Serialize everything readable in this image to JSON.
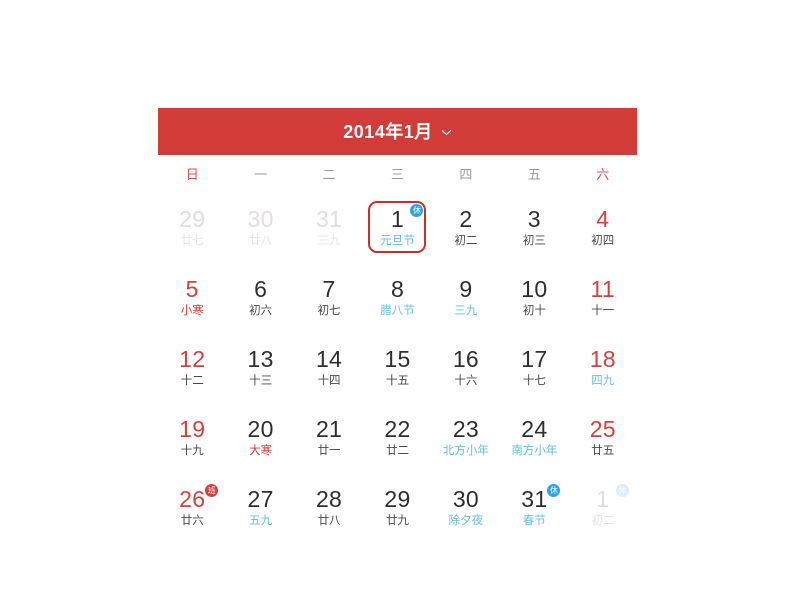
{
  "header": {
    "title": "2014年1月",
    "chevron_icon": "chevron-down-icon",
    "bar_color": "#d23c38"
  },
  "weekdays": [
    {
      "label": "日",
      "weekend": true
    },
    {
      "label": "一",
      "weekend": false
    },
    {
      "label": "二",
      "weekend": false
    },
    {
      "label": "三",
      "weekend": false
    },
    {
      "label": "四",
      "weekend": false
    },
    {
      "label": "五",
      "weekend": false
    },
    {
      "label": "六",
      "weekend": true
    }
  ],
  "colors": {
    "accent_red": "#d23c38",
    "number_red": "#d5403c",
    "lunar_blue": "#63bfe0",
    "muted": "#e2dede",
    "badge_rest": "#2ba6df",
    "badge_work": "#d5403c"
  },
  "days": [
    {
      "num": "29",
      "sub": "廿七",
      "num_class": "c-dim",
      "sub_class": "c-dim",
      "badge": "",
      "badge_class": "",
      "today": false
    },
    {
      "num": "30",
      "sub": "廿八",
      "num_class": "c-dim",
      "sub_class": "c-dim",
      "badge": "",
      "badge_class": "",
      "today": false
    },
    {
      "num": "31",
      "sub": "三九",
      "num_class": "c-dim",
      "sub_class": "c-dim",
      "badge": "",
      "badge_class": "",
      "today": false
    },
    {
      "num": "1",
      "sub": "元旦节",
      "num_class": "",
      "sub_class": "c-blue",
      "badge": "休",
      "badge_class": "b-rest",
      "today": true
    },
    {
      "num": "2",
      "sub": "初二",
      "num_class": "",
      "sub_class": "",
      "badge": "",
      "badge_class": "",
      "today": false
    },
    {
      "num": "3",
      "sub": "初三",
      "num_class": "",
      "sub_class": "",
      "badge": "",
      "badge_class": "",
      "today": false
    },
    {
      "num": "4",
      "sub": "初四",
      "num_class": "c-red",
      "sub_class": "",
      "badge": "",
      "badge_class": "",
      "today": false
    },
    {
      "num": "5",
      "sub": "小寒",
      "num_class": "c-red",
      "sub_class": "c-red",
      "badge": "",
      "badge_class": "",
      "today": false
    },
    {
      "num": "6",
      "sub": "初六",
      "num_class": "",
      "sub_class": "",
      "badge": "",
      "badge_class": "",
      "today": false
    },
    {
      "num": "7",
      "sub": "初七",
      "num_class": "",
      "sub_class": "",
      "badge": "",
      "badge_class": "",
      "today": false
    },
    {
      "num": "8",
      "sub": "腊八节",
      "num_class": "",
      "sub_class": "c-blue",
      "badge": "",
      "badge_class": "",
      "today": false
    },
    {
      "num": "9",
      "sub": "三九",
      "num_class": "",
      "sub_class": "c-blue",
      "badge": "",
      "badge_class": "",
      "today": false
    },
    {
      "num": "10",
      "sub": "初十",
      "num_class": "",
      "sub_class": "",
      "badge": "",
      "badge_class": "",
      "today": false
    },
    {
      "num": "11",
      "sub": "十一",
      "num_class": "c-red",
      "sub_class": "",
      "badge": "",
      "badge_class": "",
      "today": false
    },
    {
      "num": "12",
      "sub": "十二",
      "num_class": "c-red",
      "sub_class": "",
      "badge": "",
      "badge_class": "",
      "today": false
    },
    {
      "num": "13",
      "sub": "十三",
      "num_class": "",
      "sub_class": "",
      "badge": "",
      "badge_class": "",
      "today": false
    },
    {
      "num": "14",
      "sub": "十四",
      "num_class": "",
      "sub_class": "",
      "badge": "",
      "badge_class": "",
      "today": false
    },
    {
      "num": "15",
      "sub": "十五",
      "num_class": "",
      "sub_class": "",
      "badge": "",
      "badge_class": "",
      "today": false
    },
    {
      "num": "16",
      "sub": "十六",
      "num_class": "",
      "sub_class": "",
      "badge": "",
      "badge_class": "",
      "today": false
    },
    {
      "num": "17",
      "sub": "十七",
      "num_class": "",
      "sub_class": "",
      "badge": "",
      "badge_class": "",
      "today": false
    },
    {
      "num": "18",
      "sub": "四九",
      "num_class": "c-red",
      "sub_class": "c-blue",
      "badge": "",
      "badge_class": "",
      "today": false
    },
    {
      "num": "19",
      "sub": "十九",
      "num_class": "c-red",
      "sub_class": "",
      "badge": "",
      "badge_class": "",
      "today": false
    },
    {
      "num": "20",
      "sub": "大寒",
      "num_class": "",
      "sub_class": "c-red",
      "badge": "",
      "badge_class": "",
      "today": false
    },
    {
      "num": "21",
      "sub": "廿一",
      "num_class": "",
      "sub_class": "",
      "badge": "",
      "badge_class": "",
      "today": false
    },
    {
      "num": "22",
      "sub": "廿二",
      "num_class": "",
      "sub_class": "",
      "badge": "",
      "badge_class": "",
      "today": false
    },
    {
      "num": "23",
      "sub": "北方小年",
      "num_class": "",
      "sub_class": "c-blue",
      "badge": "",
      "badge_class": "",
      "today": false
    },
    {
      "num": "24",
      "sub": "南方小年",
      "num_class": "",
      "sub_class": "c-blue",
      "badge": "",
      "badge_class": "",
      "today": false
    },
    {
      "num": "25",
      "sub": "廿五",
      "num_class": "c-red",
      "sub_class": "",
      "badge": "",
      "badge_class": "",
      "today": false
    },
    {
      "num": "26",
      "sub": "廿六",
      "num_class": "c-red",
      "sub_class": "",
      "badge": "班",
      "badge_class": "b-work",
      "today": false
    },
    {
      "num": "27",
      "sub": "五九",
      "num_class": "",
      "sub_class": "c-blue",
      "badge": "",
      "badge_class": "",
      "today": false
    },
    {
      "num": "28",
      "sub": "廿八",
      "num_class": "",
      "sub_class": "",
      "badge": "",
      "badge_class": "",
      "today": false
    },
    {
      "num": "29",
      "sub": "廿九",
      "num_class": "",
      "sub_class": "",
      "badge": "",
      "badge_class": "",
      "today": false
    },
    {
      "num": "30",
      "sub": "除夕夜",
      "num_class": "",
      "sub_class": "c-blue",
      "badge": "",
      "badge_class": "",
      "today": false
    },
    {
      "num": "31",
      "sub": "春节",
      "num_class": "",
      "sub_class": "c-blue",
      "badge": "休",
      "badge_class": "b-rest",
      "today": false
    },
    {
      "num": "1",
      "sub": "初二",
      "num_class": "c-dim",
      "sub_class": "c-dim",
      "badge": "休",
      "badge_class": "b-dim",
      "today": false
    }
  ]
}
